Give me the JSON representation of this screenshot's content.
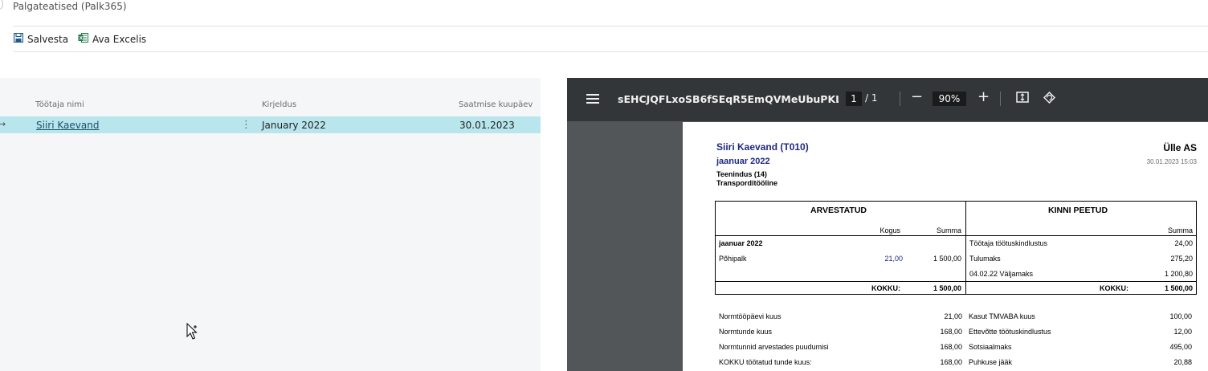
{
  "page": {
    "title": "Palgateatised (Palk365)"
  },
  "toolbar": {
    "save_label": "Salvesta",
    "excel_label": "Ava Excelis"
  },
  "list": {
    "columns": {
      "name": "Töötaja nimi",
      "description": "Kirjeldus",
      "date": "Saatmise kuupäev"
    },
    "rows": [
      {
        "name": "Siiri Kaevand",
        "description": "January 2022",
        "date": "30.01.2023"
      }
    ]
  },
  "viewer": {
    "filename": "sEHCJQFLxoSB6fSEqR5EmQVMeUbuPKLc3...",
    "page_current": "1",
    "page_total": "/ 1",
    "zoom": "90%"
  },
  "payslip": {
    "employee": "Siiri Kaevand (T010)",
    "period": "jaanuar 2022",
    "department": "Teenindus (14)",
    "position": "Transporditööline",
    "company": "Ülle AS",
    "generated": "30.01.2023 15:03",
    "left_title": "ARVESTATUD",
    "right_title": "KINNI PEETUD",
    "col_qty": "Kogus",
    "col_sum": "Summa",
    "col_sum_right": "Summa",
    "period_row": "jaanuar 2022",
    "earnings": [
      {
        "name": "Põhipalk",
        "qty": "21,00",
        "sum": "1 500,00"
      }
    ],
    "deductions": [
      {
        "name": "Töötaja töötuskindlustus",
        "sum": "24,00"
      },
      {
        "name": "Tulumaks",
        "sum": "275,20"
      },
      {
        "name": "04.02.22 Väljamaks",
        "sum": "1 200,80"
      }
    ],
    "total_label": "KOKKU:",
    "total_left": "1 500,00",
    "total_right": "1 500,00",
    "footer_left": [
      {
        "label": "Normtööpäevi kuus",
        "value": "21,00"
      },
      {
        "label": "Normtunde kuus",
        "value": "168,00"
      },
      {
        "label": "Normtunnid arvestades puudumisi",
        "value": "168,00"
      },
      {
        "label": "KOKKU töötatud tunde kuus:",
        "value": "168,00"
      }
    ],
    "footer_right": [
      {
        "label": "Kasut TMVABA kuus",
        "value": "100,00"
      },
      {
        "label": "Ettevõtte töötuskindlustus",
        "value": "12,00"
      },
      {
        "label": "Sotsiaalmaks",
        "value": "495,00"
      },
      {
        "label": "Puhkuse jääk",
        "value": "20,88"
      }
    ]
  }
}
